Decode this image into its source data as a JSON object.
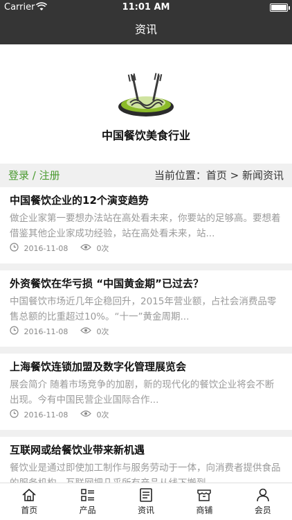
{
  "status_bar": {
    "carrier": "Carrier",
    "time": "11:01 AM"
  },
  "nav": {
    "title": "资讯"
  },
  "banner": {
    "brand": "中国餐饮美食行业"
  },
  "location": {
    "auth": "登录 / 注册",
    "crumb": "当前位置：首页 > 新闻资讯"
  },
  "articles": [
    {
      "title": "中国餐饮企业的12个演变趋势",
      "summary": "做企业家第一要想办法站在高处看未来，你要站的足够高。要想着借鉴其他企业家成功经验，站在高处看未来，站...",
      "date": "2016-11-08",
      "views": "0次"
    },
    {
      "title": "外资餐饮在华亏损 “中国黄金期”已过去？",
      "summary": "中国餐饮市场近几年企稳回升，2015年营业额，占社会消费品零售总额的比重超过10%。“十一”黄金周期...",
      "date": "2016-11-08",
      "views": "0次"
    },
    {
      "title": "上海餐饮连锁加盟及数字化管理展览会",
      "summary": "展会简介  随着市场竞争的加剧，新的现代化的餐饮企业将会不断出现。今有中国民营企业国际合作...",
      "date": "2016-11-08",
      "views": "0次"
    },
    {
      "title": "互联网或给餐饮业带来新机遇",
      "summary": "餐饮业是通过即使加工制作与服务劳动于一体，向消费者提供食品的服务机构，互联网把几乎所有产品从线下搬到...",
      "date": "",
      "views": ""
    }
  ],
  "tabs": [
    {
      "label": "首页",
      "icon": "home-icon"
    },
    {
      "label": "产品",
      "icon": "grid-list-icon"
    },
    {
      "label": "资讯",
      "icon": "news-icon"
    },
    {
      "label": "商铺",
      "icon": "shop-icon"
    },
    {
      "label": "会员",
      "icon": "user-icon"
    }
  ],
  "colors": {
    "header": "#353535",
    "accent_green": "#4a9a2f",
    "divider": "#f0f0f0"
  }
}
